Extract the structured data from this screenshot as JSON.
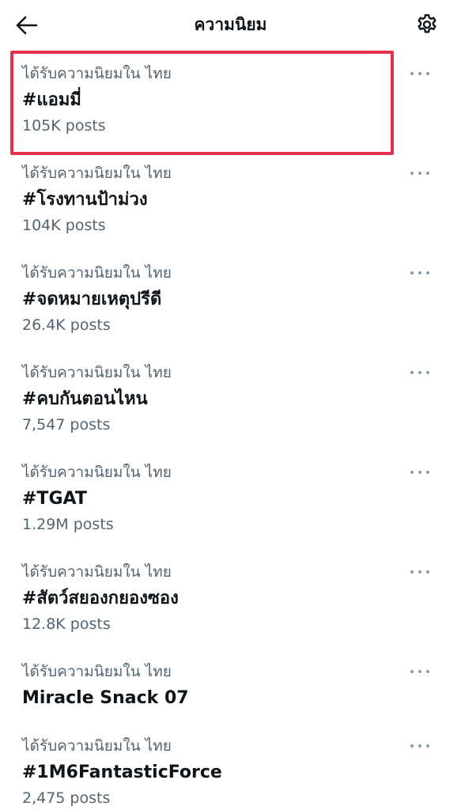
{
  "header": {
    "title": "ความนิยม",
    "back_icon": "arrow-left-icon",
    "settings_icon": "gear-icon"
  },
  "colors": {
    "highlight": "#e5314d",
    "secondary_text": "#536471",
    "primary_text": "#0f1419"
  },
  "trends": [
    {
      "context": "ได้รับความนิยมใน ไทย",
      "name": "#แอมมี่",
      "posts": "105K posts"
    },
    {
      "context": "ได้รับความนิยมใน ไทย",
      "name": "#โรงทานป้าม่วง",
      "posts": "104K posts"
    },
    {
      "context": "ได้รับความนิยมใน ไทย",
      "name": "#จดหมายเหตุปรีดี",
      "posts": "26.4K posts"
    },
    {
      "context": "ได้รับความนิยมใน ไทย",
      "name": "#คบกันตอนไหน",
      "posts": "7,547 posts"
    },
    {
      "context": "ได้รับความนิยมใน ไทย",
      "name": "#TGAT",
      "posts": "1.29M posts"
    },
    {
      "context": "ได้รับความนิยมใน ไทย",
      "name": "#สัตว์สยองกยองซอง",
      "posts": "12.8K posts"
    },
    {
      "context": "ได้รับความนิยมใน ไทย",
      "name": "Miracle Snack 07",
      "posts": ""
    },
    {
      "context": "ได้รับความนิยมใน ไทย",
      "name": "#1M6FantasticForce",
      "posts": "2,475 posts"
    }
  ]
}
